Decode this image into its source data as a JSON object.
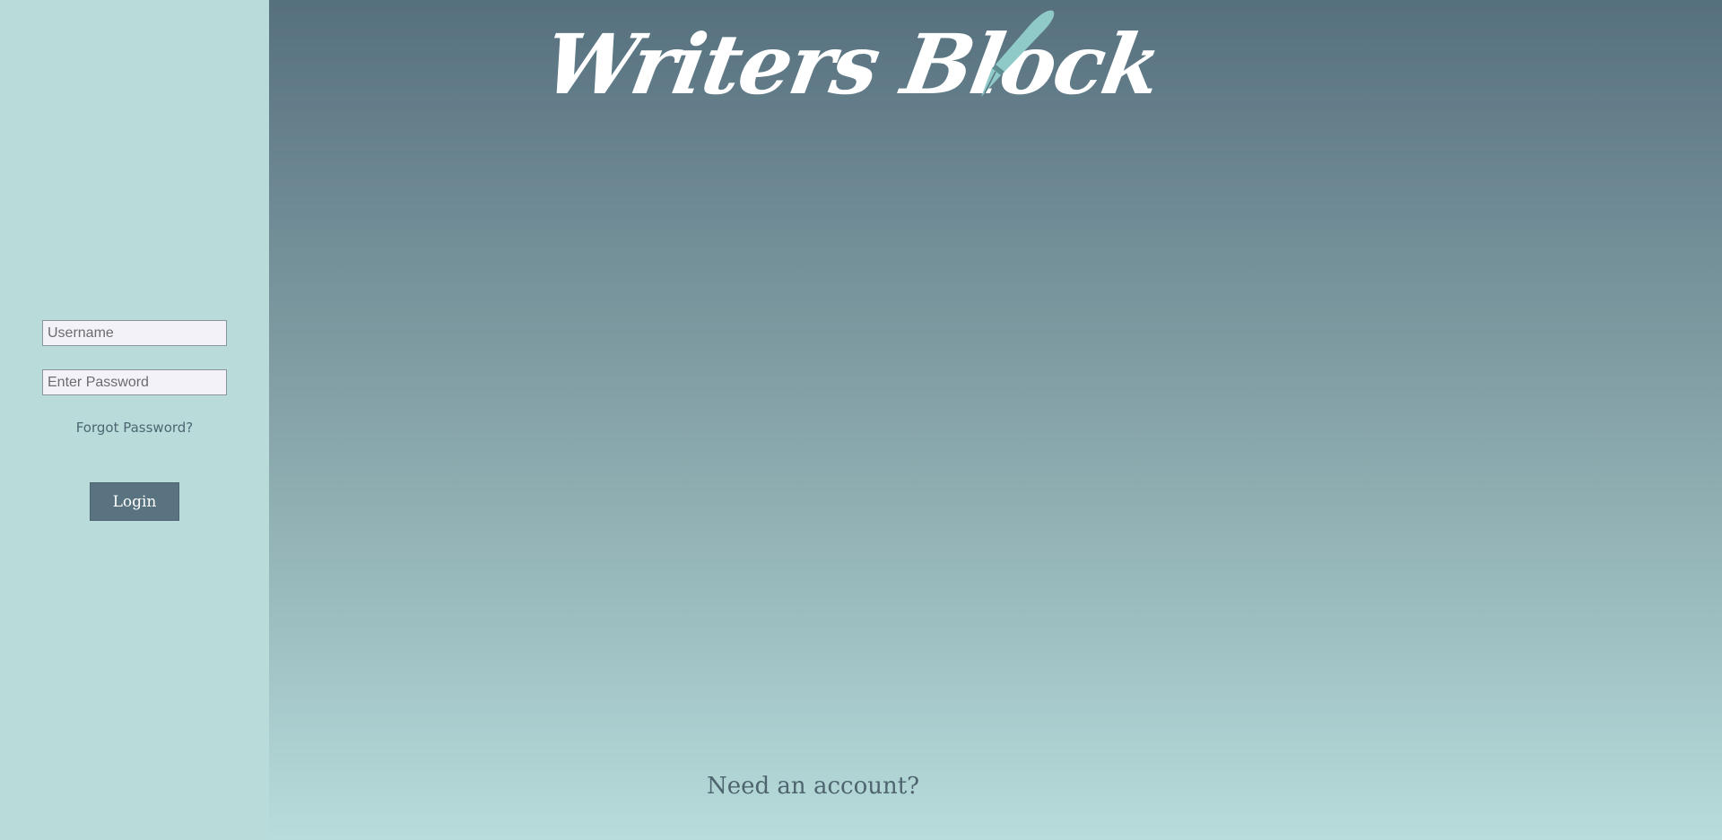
{
  "brand": {
    "logo_text": "Writers Block",
    "logo_icon": "fountain-pen-icon",
    "logo_color": "#ffffff",
    "pen_color": "#8fcac8"
  },
  "login": {
    "username_placeholder": "Username",
    "password_placeholder": "Enter Password",
    "forgot_label": "Forgot Password?",
    "login_label": "Login"
  },
  "signup": {
    "prompt": "Need an account?"
  },
  "colors": {
    "sidebar_bg": "#b9dcdb",
    "button_bg": "#5a7380",
    "gradient_top": "#56707e",
    "gradient_bottom": "#b8dcdb"
  }
}
